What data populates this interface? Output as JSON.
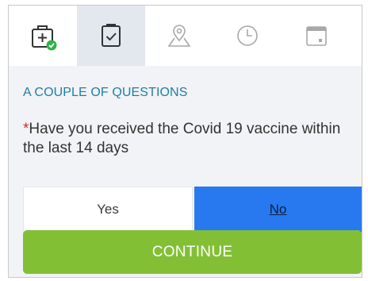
{
  "tabs": [
    {
      "icon": "medical-bag-check-icon",
      "state": "completed"
    },
    {
      "icon": "clipboard-check-icon",
      "state": "active"
    },
    {
      "icon": "map-pin-icon",
      "state": "disabled"
    },
    {
      "icon": "clock-icon",
      "state": "disabled"
    },
    {
      "icon": "calendar-icon",
      "state": "disabled"
    }
  ],
  "section": {
    "title": "A COUPLE OF QUESTIONS"
  },
  "question": {
    "required_marker": "*",
    "text": "Have you received the Covid 19 vaccine within the last 14 days"
  },
  "answers": {
    "yes_label": "Yes",
    "no_label": "No",
    "selected": "No"
  },
  "actions": {
    "continue_label": "CONTINUE"
  },
  "colors": {
    "accent": "#1f7ea8",
    "selected": "#2879f0",
    "continue": "#83bf35",
    "required": "#d12a2a",
    "check": "#2fb34a"
  }
}
